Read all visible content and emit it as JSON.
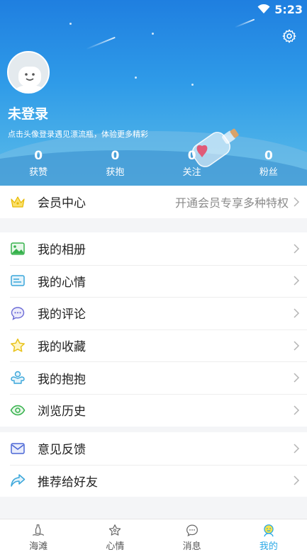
{
  "status_bar": {
    "time": "5:23"
  },
  "profile": {
    "nickname": "未登录",
    "login_hint": "点击头像登录遇见漂流瓶，体验更多精彩"
  },
  "stats": [
    {
      "count": "0",
      "label": "获赞"
    },
    {
      "count": "0",
      "label": "获抱"
    },
    {
      "count": "0",
      "label": "关注"
    },
    {
      "count": "0",
      "label": "粉丝"
    }
  ],
  "vip": {
    "label": "会员中心",
    "promo": "开通会员专享多种特权"
  },
  "menu_group_1": [
    {
      "label": "我的相册",
      "icon": "photo-album-icon"
    },
    {
      "label": "我的心情",
      "icon": "mood-card-icon"
    },
    {
      "label": "我的评论",
      "icon": "comment-bubble-icon"
    },
    {
      "label": "我的收藏",
      "icon": "star-icon"
    },
    {
      "label": "我的抱抱",
      "icon": "hug-icon"
    },
    {
      "label": "浏览历史",
      "icon": "eye-icon"
    }
  ],
  "menu_group_2": [
    {
      "label": "意见反馈",
      "icon": "mail-icon"
    },
    {
      "label": "推荐给好友",
      "icon": "share-arrow-icon"
    }
  ],
  "tabs": [
    {
      "label": "海滩",
      "icon": "beach-bottle-icon"
    },
    {
      "label": "心情",
      "icon": "mood-star-icon"
    },
    {
      "label": "消息",
      "icon": "message-icon"
    },
    {
      "label": "我的",
      "icon": "profile-face-icon",
      "active": true
    }
  ],
  "colors": {
    "header_top": "#1f7fe0",
    "accent": "#2aa8e6",
    "background": "#f4f5f7"
  }
}
